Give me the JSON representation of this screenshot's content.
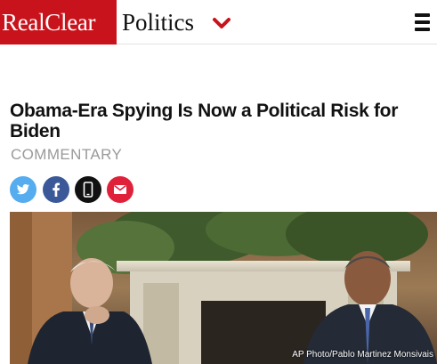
{
  "header": {
    "brand_part1": "RealClear",
    "brand_part2": "Politics",
    "brand_color": "#c8131c"
  },
  "article": {
    "headline": "Obama-Era Spying Is Now a Political Risk for Biden",
    "section": "COMMENTARY",
    "photo_credit": "AP Photo/Pablo Martinez Monsivais"
  },
  "share": [
    {
      "icon": "twitter-icon",
      "color": "#55acee"
    },
    {
      "icon": "facebook-icon",
      "color": "#3b5998"
    },
    {
      "icon": "mobile-phone-icon",
      "color": "#111111"
    },
    {
      "icon": "email-icon",
      "color": "#e0213a"
    }
  ]
}
